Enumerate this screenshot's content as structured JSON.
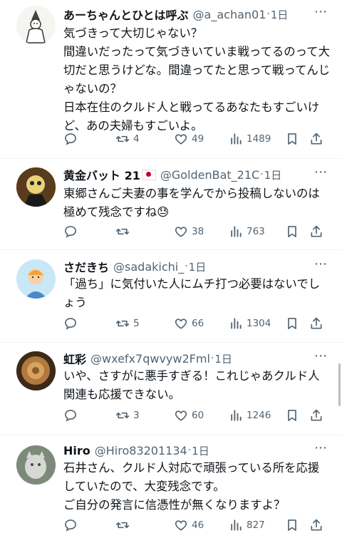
{
  "tweets": [
    {
      "name": "あーちゃんとひとは呼ぶ",
      "handle": "@a_achan01",
      "time": "1日",
      "text": "気づきって大切じゃない？\n間違いだったって気づきいていま戦ってるのって大切だと思うけどな。間違ってたと思って戦ってんじゃないの？\n日本在住のクルド人と戦ってるあなたもすごいけど、あの夫婦もすごいよ。",
      "replies": "",
      "retweets": "4",
      "likes": "49",
      "views": "1489"
    },
    {
      "name": "黄金バット 21",
      "flag": "🇯🇵",
      "handle": "@GoldenBat_21C",
      "time": "1日",
      "text": "東郷さんご夫妻の事を学んでから投稿しないのは極めて残念ですね😓",
      "replies": "",
      "retweets": "",
      "likes": "38",
      "views": "763"
    },
    {
      "name": "さだきち",
      "handle": "@sadakichi_",
      "time": "1日",
      "text": "「過ち」に気付いた人にムチ打つ必要はないでしょう",
      "replies": "",
      "retweets": "5",
      "likes": "66",
      "views": "1304"
    },
    {
      "name": "虹彩",
      "handle": "@wxefx7qwvyw2Fml",
      "time": "1日",
      "text": "いや、さすがに悪手すぎる！これじゃあクルド人関連も応援できない。",
      "replies": "",
      "retweets": "3",
      "likes": "60",
      "views": "1246"
    },
    {
      "name": "Hiro",
      "handle": "@Hiro83201134",
      "time": "1日",
      "text": "石井さん、クルド人対応で頑張っている所を応援していたので、大変残念です。\nご自分の発言に信憑性が無くなりますよ？",
      "replies": "",
      "retweets": "",
      "likes": "46",
      "views": "827"
    }
  ],
  "icons": {
    "reply": "speech-bubble-icon",
    "retweet": "retweet-arrows-icon",
    "like": "heart-icon",
    "views": "bar-chart-icon",
    "bookmark": "bookmark-icon",
    "share": "share-arrow-icon",
    "more": "more-dots-icon"
  },
  "colors": {
    "text": "#0f1419",
    "muted": "#536471",
    "divider": "#eff3f4"
  },
  "separator": "·",
  "more_glyph": "⋯"
}
